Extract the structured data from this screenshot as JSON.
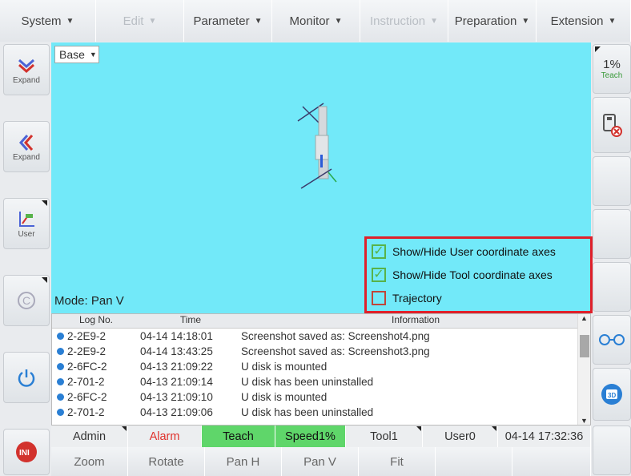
{
  "menubar": {
    "items": [
      {
        "label": "System",
        "caret": "▼",
        "disabled": false
      },
      {
        "label": "Edit",
        "caret": "▼",
        "disabled": true
      },
      {
        "label": "Parameter",
        "caret": "▼",
        "disabled": false
      },
      {
        "label": "Monitor",
        "caret": "▼",
        "disabled": false
      },
      {
        "label": "Instruction",
        "caret": "▼",
        "disabled": true
      },
      {
        "label": "Preparation",
        "caret": "▼",
        "disabled": false
      },
      {
        "label": "Extension",
        "caret": "▼",
        "disabled": false
      }
    ]
  },
  "left": {
    "expand_down": "Expand",
    "expand_left": "Expand",
    "user": "User"
  },
  "right": {
    "speed": "1%",
    "mode": "Teach"
  },
  "viewport": {
    "frame_select": "Base",
    "mode": "Mode: Pan V",
    "options": [
      {
        "label": "Show/Hide User coordinate axes",
        "checked": true
      },
      {
        "label": "Show/Hide Tool coordinate axes",
        "checked": true
      },
      {
        "label": "Trajectory",
        "checked": false
      }
    ]
  },
  "log": {
    "columns": [
      "Log No.",
      "Time",
      "Information"
    ],
    "rows": [
      {
        "no": "2-2E9-2",
        "time": "04-14 14:18:01",
        "info": "Screenshot saved as: Screenshot4.png"
      },
      {
        "no": "2-2E9-2",
        "time": "04-14 13:43:25",
        "info": "Screenshot saved as: Screenshot3.png"
      },
      {
        "no": "2-6FC-2",
        "time": "04-13 21:09:22",
        "info": "U disk is mounted"
      },
      {
        "no": "2-701-2",
        "time": "04-13 21:09:14",
        "info": "U disk has been uninstalled"
      },
      {
        "no": "2-6FC-2",
        "time": "04-13 21:09:10",
        "info": "U disk is mounted"
      },
      {
        "no": "2-701-2",
        "time": "04-13 21:09:06",
        "info": "U disk has been uninstalled"
      }
    ]
  },
  "status": {
    "admin": "Admin",
    "alarm": "Alarm",
    "teach": "Teach",
    "speed": "Speed1%",
    "tool": "Tool1",
    "user": "User0",
    "datetime": "04-14 17:32:36"
  },
  "bottom": {
    "zoom": "Zoom",
    "rotate": "Rotate",
    "pan_h": "Pan H",
    "pan_v": "Pan V",
    "fit": "Fit"
  },
  "colors": {
    "viewport_bg": "#72e9f9",
    "highlight": "#e0202a",
    "teach_green": "#5fd66a",
    "alarm_red": "#e0302a"
  }
}
